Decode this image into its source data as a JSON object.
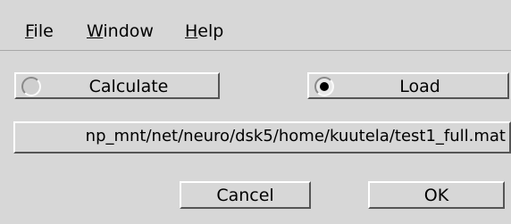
{
  "menu": {
    "file": {
      "mnemonic": "F",
      "rest": "ile"
    },
    "window": {
      "mnemonic": "W",
      "rest": "indow"
    },
    "help": {
      "mnemonic": "H",
      "rest": "elp"
    }
  },
  "options": {
    "calculate": {
      "label": "Calculate",
      "selected": false
    },
    "load": {
      "label": "Load",
      "selected": true
    }
  },
  "path": {
    "value": "np_mnt/net/neuro/dsk5/home/kuutela/test1_full.mat"
  },
  "buttons": {
    "cancel": "Cancel",
    "ok": "OK"
  }
}
